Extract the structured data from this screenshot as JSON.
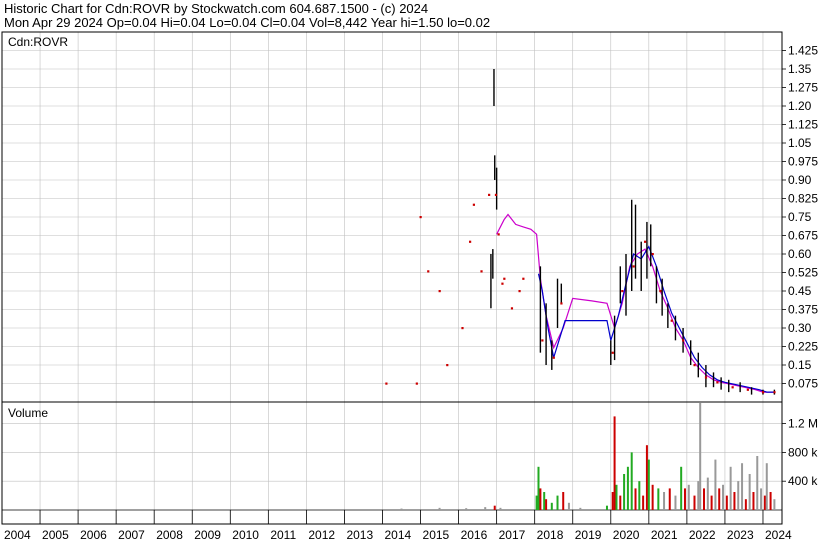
{
  "header": {
    "line1": "Historic Chart for Cdn:ROVR by Stockwatch.com 604.687.1500 - (c) 2024",
    "line2": "Mon Apr 29 2024  Op=0.04  Hi=0.04  Lo=0.04  Cl=0.04  Vol=8,442  Year hi=1.50  lo=0.02"
  },
  "colors": {
    "background": "#ffffff",
    "grid": "#c0c0c0",
    "price_bar": "#000000",
    "close_mark": "#cc0000",
    "ma_short": "#0000cc",
    "ma_long": "#cc00cc",
    "volume_up": "#22aa22",
    "volume_down": "#cc0000",
    "volume_neutral": "#999999"
  },
  "chart_data": [
    {
      "type": "line",
      "label": "Cdn:ROVR",
      "ylim": [
        0,
        1.5
      ],
      "yticks": [
        "1.425",
        "1.35",
        "1.275",
        "1.20",
        "1.125",
        "1.05",
        "0.975",
        "0.90",
        "0.825",
        "0.75",
        "0.675",
        "0.60",
        "0.525",
        "0.45",
        "0.375",
        "0.30",
        "0.225",
        "0.15",
        "0.075"
      ],
      "x_years": [
        "2004",
        "2005",
        "2006",
        "2007",
        "2008",
        "2009",
        "2010",
        "2011",
        "2012",
        "2013",
        "2014",
        "2015",
        "2016",
        "2017",
        "2018",
        "2019",
        "2020",
        "2021",
        "2022",
        "2023",
        "2024"
      ],
      "grid": true,
      "price_bars": [
        [
          2016.85,
          0.38,
          0.6
        ],
        [
          2016.9,
          0.5,
          0.62
        ],
        [
          2016.93,
          1.2,
          1.35
        ],
        [
          2016.95,
          0.9,
          1.0
        ],
        [
          2017.0,
          0.78,
          0.95
        ],
        [
          2018.15,
          0.2,
          0.55
        ],
        [
          2018.3,
          0.15,
          0.4
        ],
        [
          2018.45,
          0.13,
          0.25
        ],
        [
          2018.6,
          0.3,
          0.5
        ],
        [
          2018.7,
          0.4,
          0.48
        ],
        [
          2020.0,
          0.15,
          0.25
        ],
        [
          2020.1,
          0.17,
          0.35
        ],
        [
          2020.25,
          0.4,
          0.55
        ],
        [
          2020.4,
          0.35,
          0.6
        ],
        [
          2020.55,
          0.45,
          0.82
        ],
        [
          2020.65,
          0.5,
          0.8
        ],
        [
          2020.8,
          0.45,
          0.65
        ],
        [
          2020.95,
          0.5,
          0.73
        ],
        [
          2021.05,
          0.55,
          0.72
        ],
        [
          2021.2,
          0.4,
          0.55
        ],
        [
          2021.35,
          0.35,
          0.5
        ],
        [
          2021.5,
          0.3,
          0.4
        ],
        [
          2021.7,
          0.25,
          0.35
        ],
        [
          2021.9,
          0.2,
          0.3
        ],
        [
          2022.1,
          0.15,
          0.25
        ],
        [
          2022.3,
          0.1,
          0.2
        ],
        [
          2022.5,
          0.06,
          0.15
        ],
        [
          2022.7,
          0.06,
          0.12
        ],
        [
          2022.9,
          0.05,
          0.1
        ],
        [
          2023.1,
          0.04,
          0.09
        ],
        [
          2023.4,
          0.04,
          0.08
        ],
        [
          2023.7,
          0.03,
          0.06
        ],
        [
          2024.0,
          0.03,
          0.05
        ],
        [
          2024.3,
          0.03,
          0.05
        ]
      ],
      "close_points": [
        [
          2014.1,
          0.075
        ],
        [
          2014.9,
          0.075
        ],
        [
          2015.0,
          0.75
        ],
        [
          2015.2,
          0.53
        ],
        [
          2015.5,
          0.45
        ],
        [
          2015.7,
          0.15
        ],
        [
          2016.1,
          0.3
        ],
        [
          2016.3,
          0.65
        ],
        [
          2016.4,
          0.8
        ],
        [
          2016.6,
          0.53
        ],
        [
          2016.8,
          0.84
        ],
        [
          2016.98,
          0.84
        ],
        [
          2017.05,
          0.68
        ],
        [
          2017.15,
          0.48
        ],
        [
          2017.2,
          0.5
        ],
        [
          2017.4,
          0.38
        ],
        [
          2017.6,
          0.45
        ],
        [
          2017.7,
          0.5
        ],
        [
          2018.2,
          0.25
        ],
        [
          2018.5,
          0.18
        ],
        [
          2018.7,
          0.4
        ],
        [
          2020.05,
          0.2
        ],
        [
          2020.3,
          0.45
        ],
        [
          2020.6,
          0.55
        ],
        [
          2020.9,
          0.65
        ],
        [
          2021.1,
          0.6
        ],
        [
          2021.3,
          0.45
        ],
        [
          2021.6,
          0.33
        ],
        [
          2021.9,
          0.25
        ],
        [
          2022.2,
          0.15
        ],
        [
          2022.5,
          0.1
        ],
        [
          2022.8,
          0.08
        ],
        [
          2023.2,
          0.06
        ],
        [
          2023.6,
          0.05
        ],
        [
          2024.0,
          0.04
        ],
        [
          2024.3,
          0.04
        ]
      ],
      "series": [
        {
          "color": "#cc00cc",
          "x": [
            2017.0,
            2017.2,
            2017.3,
            2017.5,
            2017.7,
            2017.9,
            2018.05,
            2018.15,
            2018.3,
            2018.5,
            2018.75,
            2019.0,
            2019.5,
            2019.9,
            2020.1,
            2020.3,
            2020.5,
            2020.7,
            2020.9,
            2021.1,
            2021.3,
            2021.5,
            2021.7,
            2021.9,
            2022.1,
            2022.3,
            2022.5,
            2022.7,
            2022.9,
            2023.2,
            2023.5,
            2023.8,
            2024.0,
            2024.3
          ],
          "values": [
            0.68,
            0.74,
            0.76,
            0.72,
            0.71,
            0.7,
            0.68,
            0.5,
            0.35,
            0.22,
            0.3,
            0.42,
            0.41,
            0.4,
            0.3,
            0.4,
            0.55,
            0.6,
            0.62,
            0.55,
            0.45,
            0.38,
            0.3,
            0.25,
            0.18,
            0.14,
            0.11,
            0.09,
            0.08,
            0.07,
            0.06,
            0.05,
            0.04,
            0.04
          ]
        },
        {
          "color": "#0000cc",
          "x": [
            2018.1,
            2018.2,
            2018.35,
            2018.5,
            2018.7,
            2018.8,
            2019.0,
            2019.5,
            2019.9,
            2020.0,
            2020.2,
            2020.4,
            2020.6,
            2020.8,
            2021.0,
            2021.2,
            2021.4,
            2021.6,
            2021.8,
            2022.0,
            2022.2,
            2022.4,
            2022.6,
            2022.8,
            2023.0,
            2023.3,
            2023.6,
            2023.9,
            2024.1,
            2024.3
          ],
          "values": [
            0.52,
            0.45,
            0.3,
            0.18,
            0.28,
            0.33,
            0.33,
            0.33,
            0.33,
            0.25,
            0.35,
            0.48,
            0.6,
            0.58,
            0.63,
            0.55,
            0.45,
            0.36,
            0.3,
            0.24,
            0.18,
            0.14,
            0.11,
            0.09,
            0.08,
            0.07,
            0.06,
            0.05,
            0.04,
            0.04
          ]
        }
      ]
    },
    {
      "type": "bar",
      "label": "Volume",
      "ylim": [
        0,
        1500000
      ],
      "yticks": [
        "1.2 M",
        "800 k",
        "400 k"
      ],
      "ytick_values": [
        1200000,
        800000,
        400000
      ],
      "x_years": [
        "2004",
        "2005",
        "2006",
        "2007",
        "2008",
        "2009",
        "2010",
        "2011",
        "2012",
        "2013",
        "2014",
        "2015",
        "2016",
        "2017",
        "2018",
        "2019",
        "2020",
        "2021",
        "2022",
        "2023",
        "2024"
      ],
      "grid": true,
      "bars": [
        [
          2014.5,
          20000,
          "n"
        ],
        [
          2015.5,
          30000,
          "n"
        ],
        [
          2016.2,
          25000,
          "n"
        ],
        [
          2016.7,
          40000,
          "n"
        ],
        [
          2016.95,
          60000,
          "d"
        ],
        [
          2017.1,
          30000,
          "n"
        ],
        [
          2018.05,
          200000,
          "u"
        ],
        [
          2018.1,
          600000,
          "u"
        ],
        [
          2018.15,
          300000,
          "d"
        ],
        [
          2018.25,
          250000,
          "u"
        ],
        [
          2018.3,
          150000,
          "d"
        ],
        [
          2018.45,
          100000,
          "u"
        ],
        [
          2018.6,
          200000,
          "u"
        ],
        [
          2018.75,
          250000,
          "d"
        ],
        [
          2018.9,
          100000,
          "n"
        ],
        [
          2019.2,
          30000,
          "n"
        ],
        [
          2019.9,
          60000,
          "u"
        ],
        [
          2020.05,
          250000,
          "d"
        ],
        [
          2020.1,
          1300000,
          "d"
        ],
        [
          2020.15,
          350000,
          "u"
        ],
        [
          2020.25,
          200000,
          "d"
        ],
        [
          2020.35,
          500000,
          "u"
        ],
        [
          2020.45,
          600000,
          "u"
        ],
        [
          2020.55,
          800000,
          "u"
        ],
        [
          2020.65,
          300000,
          "d"
        ],
        [
          2020.75,
          400000,
          "u"
        ],
        [
          2020.85,
          200000,
          "d"
        ],
        [
          2020.95,
          900000,
          "d"
        ],
        [
          2021.0,
          700000,
          "u"
        ],
        [
          2021.1,
          350000,
          "d"
        ],
        [
          2021.25,
          300000,
          "u"
        ],
        [
          2021.4,
          250000,
          "n"
        ],
        [
          2021.55,
          300000,
          "d"
        ],
        [
          2021.7,
          200000,
          "n"
        ],
        [
          2021.85,
          600000,
          "u"
        ],
        [
          2021.95,
          300000,
          "d"
        ],
        [
          2022.05,
          350000,
          "n"
        ],
        [
          2022.2,
          200000,
          "d"
        ],
        [
          2022.3,
          400000,
          "n"
        ],
        [
          2022.35,
          1550000,
          "n"
        ],
        [
          2022.45,
          300000,
          "d"
        ],
        [
          2022.55,
          450000,
          "n"
        ],
        [
          2022.65,
          200000,
          "d"
        ],
        [
          2022.75,
          700000,
          "n"
        ],
        [
          2022.85,
          300000,
          "d"
        ],
        [
          2022.95,
          350000,
          "n"
        ],
        [
          2023.05,
          200000,
          "d"
        ],
        [
          2023.15,
          600000,
          "n"
        ],
        [
          2023.25,
          250000,
          "d"
        ],
        [
          2023.35,
          400000,
          "n"
        ],
        [
          2023.45,
          650000,
          "n"
        ],
        [
          2023.55,
          150000,
          "d"
        ],
        [
          2023.65,
          500000,
          "n"
        ],
        [
          2023.75,
          250000,
          "d"
        ],
        [
          2023.85,
          750000,
          "n"
        ],
        [
          2023.95,
          300000,
          "n"
        ],
        [
          2024.05,
          200000,
          "d"
        ],
        [
          2024.1,
          650000,
          "n"
        ],
        [
          2024.2,
          250000,
          "d"
        ],
        [
          2024.3,
          150000,
          "n"
        ]
      ]
    }
  ]
}
